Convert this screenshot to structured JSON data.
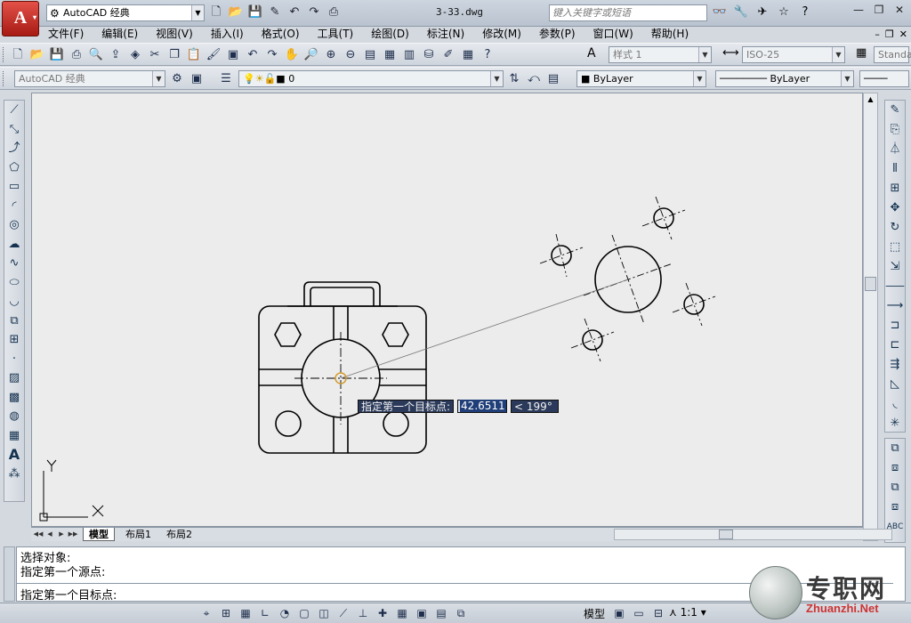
{
  "app": {
    "logo_letter": "A",
    "logo_sub": "▾",
    "workspace": "AutoCAD 经典",
    "document_title": "3-33.dwg",
    "search_placeholder": "键入关键字或短语"
  },
  "menu": [
    "文件(F)",
    "编辑(E)",
    "视图(V)",
    "插入(I)",
    "格式(O)",
    "工具(T)",
    "绘图(D)",
    "标注(N)",
    "修改(M)",
    "参数(P)",
    "窗口(W)",
    "帮助(H)"
  ],
  "styles_toolbar": {
    "text_style": "样式 1",
    "dim_style": "ISO-25",
    "table_style": "Standa"
  },
  "layers_toolbar": {
    "workspace_combo": "AutoCAD 经典",
    "layer": "0",
    "color": "ByLayer",
    "linetype": "ByLayer"
  },
  "layout_tabs": [
    "模型",
    "布局1",
    "布局2"
  ],
  "command_lines": [
    "选择对象:",
    "指定第一个源点:"
  ],
  "command_prompt": "指定第一个目标点:",
  "dynamic_input": {
    "prompt": "指定第一个目标点:",
    "distance": "42.6511",
    "angle": "< 199°"
  },
  "ucs": {
    "x": "X",
    "y": "Y"
  },
  "status": {
    "model": "模型",
    "annotation_scale": "1:1"
  },
  "watermark": {
    "text": "专职网",
    "url": "Zhuanzhi.Net"
  }
}
